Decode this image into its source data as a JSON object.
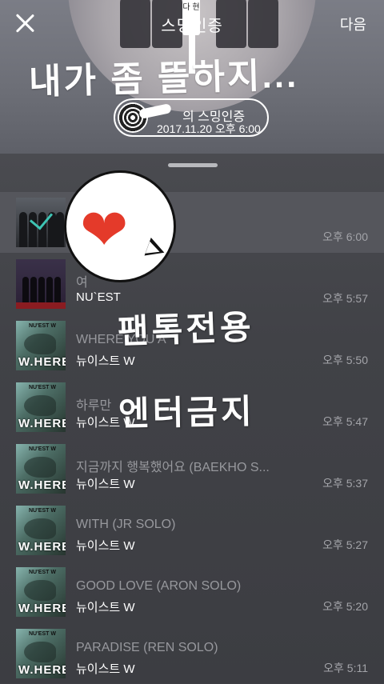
{
  "header": {
    "title": "스밍인증",
    "next_label": "다음",
    "hole_text": "다 현",
    "overlay_text": "내가 좀 뜰하지...",
    "auth": {
      "title": "의 스밍인증",
      "date": "2017.11.20 오후 6:00"
    }
  },
  "list": {
    "songs": [
      {
        "title": "",
        "artist": "",
        "time": "오후 6:00",
        "art": "group",
        "selected": true
      },
      {
        "title": "여",
        "artist": "NU`EST",
        "time": "오후 5:57",
        "art": "nuest",
        "selected": false
      },
      {
        "title": "WHERE YOU A",
        "artist": "뉴이스트 W",
        "time": "오후 5:50",
        "art": "where",
        "selected": false
      },
      {
        "title": "하루만",
        "artist": "뉴이스트 W",
        "time": "오후 5:47",
        "art": "where",
        "selected": false
      },
      {
        "title": "지금까지 행복했어요 (BAEKHO S...",
        "artist": "뉴이스트 W",
        "time": "오후 5:37",
        "art": "where",
        "selected": false
      },
      {
        "title": "WITH (JR SOLO)",
        "artist": "뉴이스트 W",
        "time": "오후 5:27",
        "art": "where",
        "selected": false
      },
      {
        "title": "GOOD LOVE (ARON SOLO)",
        "artist": "뉴이스트 W",
        "time": "오후 5:20",
        "art": "where",
        "selected": false
      },
      {
        "title": "PARADISE (REN SOLO)",
        "artist": "뉴이스트 W",
        "time": "오후 5:11",
        "art": "where",
        "selected": false
      }
    ],
    "art_label": "W.HERE",
    "art_tag": "NU'EST W"
  },
  "stickers": {
    "line1": "팬톡전용",
    "line2": "엔터금지",
    "heart_icon": "heart-icon",
    "heart_color": "#e43a2a"
  }
}
